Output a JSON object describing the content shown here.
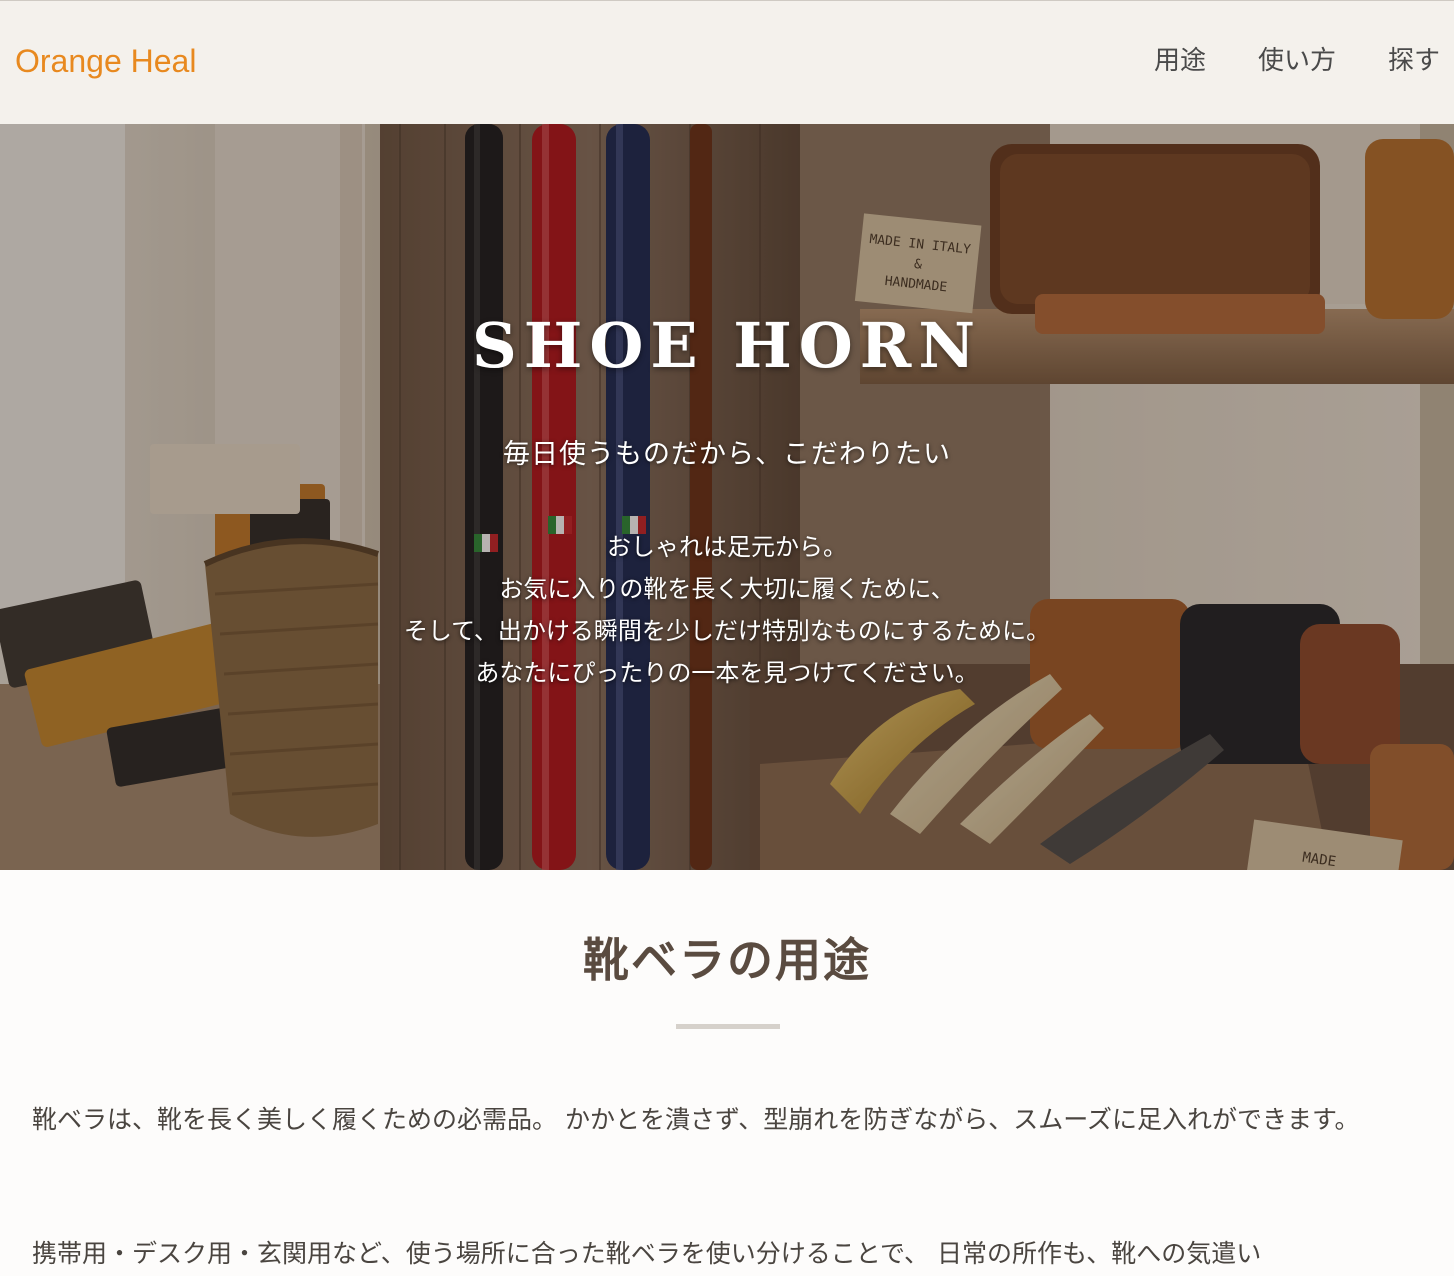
{
  "header": {
    "brand": "Orange Heal",
    "nav": [
      "用途",
      "使い方",
      "探す"
    ]
  },
  "hero": {
    "title": "SHOE HORN",
    "subtitle": "毎日使うものだから、こだわりたい",
    "lines": [
      "おしゃれは足元から。",
      "お気に入りの靴を長く大切に履くために、",
      "そして、出かける瞬間を少しだけ特別なものにするために。",
      "あなたにぴったりの一本を見つけてください。"
    ],
    "photo_signs": {
      "sign_top": [
        "MADE IN ITALY",
        "&",
        "HANDMADE"
      ],
      "sign_bottom": "MADE"
    }
  },
  "section": {
    "title": "靴ベラの用途",
    "paragraphs": [
      "靴ベラは、靴を長く美しく履くための必需品。 かかとを潰さず、型崩れを防ぎながら、スムーズに足入れができます。",
      "携帯用・デスク用・玄関用など、使う場所に合った靴ベラを使い分けることで、 日常の所作も、靴への気遣い"
    ]
  },
  "colors": {
    "brand": "#e8891f",
    "header_bg": "#f4f1ec",
    "heading": "#5a4b40",
    "body_text": "#4a4540"
  }
}
